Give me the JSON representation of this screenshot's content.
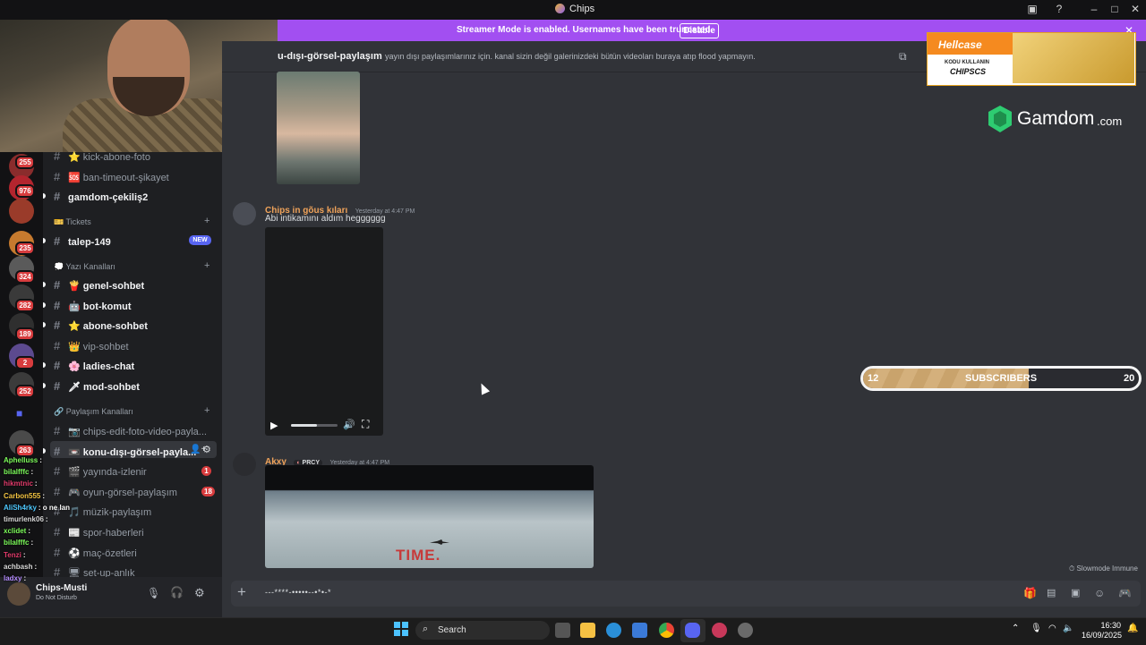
{
  "window": {
    "title": "Chips"
  },
  "banner": {
    "text": "Streamer Mode is enabled. Usernames have been truncated.",
    "disable_label": "Disable"
  },
  "servers": {
    "badges": [
      "255",
      "976",
      "235",
      "324",
      "282",
      "189",
      "2",
      "252",
      "263"
    ]
  },
  "channels": {
    "top": [
      {
        "label": "⭐ kick-abone-foto",
        "bright": false
      },
      {
        "label": "🆘 ban-timeout-şikayet",
        "bright": false
      },
      {
        "label": "gamdom-çekiliş2",
        "bright": true
      }
    ],
    "tickets_category": "🎫 Tickets",
    "tickets": [
      {
        "label": "talep-149",
        "bright": true,
        "badge": "NEW"
      }
    ],
    "text_category": "💭 Yazı Kanalları",
    "text": [
      {
        "label": "🍟 genel-sohbet",
        "bright": true
      },
      {
        "label": "🤖 bot-komut",
        "bright": true
      },
      {
        "label": "⭐ abone-sohbet",
        "bright": true
      },
      {
        "label": "👑 vip-sohbet",
        "bright": false
      },
      {
        "label": "🌸 ladies-chat",
        "bright": true
      },
      {
        "label": "🗡 mod-sohbet",
        "bright": true
      }
    ],
    "share_category": "🔗 Paylaşım Kanalları",
    "share": [
      {
        "label": "📷 chips-edit-foto-video-payla...",
        "bright": false
      },
      {
        "label": "📼 konu-dışı-görsel-payla...",
        "bright": true,
        "selected": true
      },
      {
        "label": "🎬 yayında-izlenir",
        "bright": false,
        "badge": "1"
      },
      {
        "label": "🎮 oyun-görsel-paylaşım",
        "bright": false,
        "badge": "18"
      },
      {
        "label": "🎵 müzik-paylaşım",
        "bright": false
      },
      {
        "label": "📰 spor-haberleri",
        "bright": false
      },
      {
        "label": "⚽ maç-özetleri",
        "bright": false
      },
      {
        "label": "🖥 set-up-anlık",
        "bright": false
      }
    ]
  },
  "user": {
    "name": "Chips-Musti",
    "status": "Do Not Disturb"
  },
  "channel_header": {
    "name": "u-dışı-görsel-paylaşım",
    "topic": "yayın dışı paylaşımlarınız için. kanal sizin değil galerinizdeki bütün videoları buraya atıp flood yapmayın."
  },
  "messages": [
    {
      "author": "Chips in gõus kıları",
      "author_color": "#f0a35a",
      "timestamp": "Yesterday at 4:47 PM",
      "text": "Abi intikamını aldım hegggggg"
    },
    {
      "author": "Akxy",
      "author_color": "#f0a35a",
      "tag": "PRCY",
      "timestamp": "Yesterday at 4:47 PM",
      "embed_text": "TIME."
    }
  ],
  "video": {
    "progress": 0.55
  },
  "composer": {
    "value": "---****-•••••--•*•-*",
    "slowmode": "Slowmode Immune"
  },
  "subscribers": {
    "current": "12",
    "label": "SUBSCRIBERS",
    "goal": "20",
    "progress": 0.6
  },
  "ads": {
    "hellcase_brand": "Hellcase",
    "hellcase_line1": "KODU KULLANIN",
    "hellcase_code": "CHIPSCS",
    "gamdom_name": "Gamdom",
    "gamdom_suffix": ".com"
  },
  "overlay_chat": [
    {
      "name": "Aphelluss",
      "color": "#7cfc5a",
      "text": ":"
    },
    {
      "name": "bilalfffc",
      "color": "#7cfc5a",
      "text": ":"
    },
    {
      "name": "hikmtnic",
      "color": "#e23b6b",
      "text": ":"
    },
    {
      "name": "Carbon555",
      "color": "#f5c542",
      "text": ":"
    },
    {
      "name": "AliSh4rky",
      "color": "#4ec9ff",
      "text": ": o ne lan"
    },
    {
      "name": "timurlenk06",
      "color": "#d8d8d8",
      "text": ":"
    },
    {
      "name": "xclidet",
      "color": "#7cfc5a",
      "text": ":"
    },
    {
      "name": "bilalfffc",
      "color": "#7cfc5a",
      "text": ":"
    },
    {
      "name": "Tenzi",
      "color": "#e23b6b",
      "text": ":"
    },
    {
      "name": "achbash",
      "color": "#d8d8d8",
      "text": ":"
    },
    {
      "name": "ladxy",
      "color": "#b58cff",
      "text": ":"
    }
  ],
  "taskbar": {
    "search": "Search",
    "time": "16:30",
    "date": "16/09/2025"
  },
  "colors": {
    "banner": "#a24ff1",
    "accent": "#5865f2",
    "unread_badge": "#d83c3e"
  }
}
